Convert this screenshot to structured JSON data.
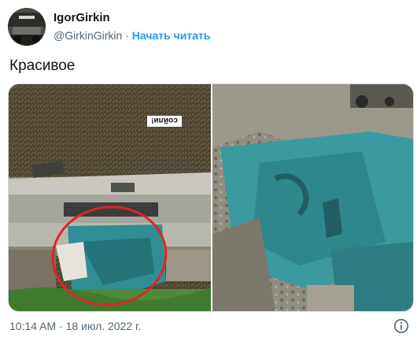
{
  "author": {
    "name": "IgorGirkin",
    "handle": "@GirkinGirkin",
    "separator": "·",
    "follow_label": "Начать читать"
  },
  "tweet": {
    "text": "Красивое"
  },
  "media": {
    "left_photo_sign": "сойли!"
  },
  "footer": {
    "timestamp": "10:14 AM · 18 июл. 2022 г."
  },
  "icons": {
    "info": "info-icon"
  },
  "colors": {
    "accent": "#1d9bf0",
    "secondary_text": "#536471",
    "primary_text": "#0f1419",
    "circle_annotation": "#e0242a",
    "panel_teal": "#2f8f94"
  }
}
